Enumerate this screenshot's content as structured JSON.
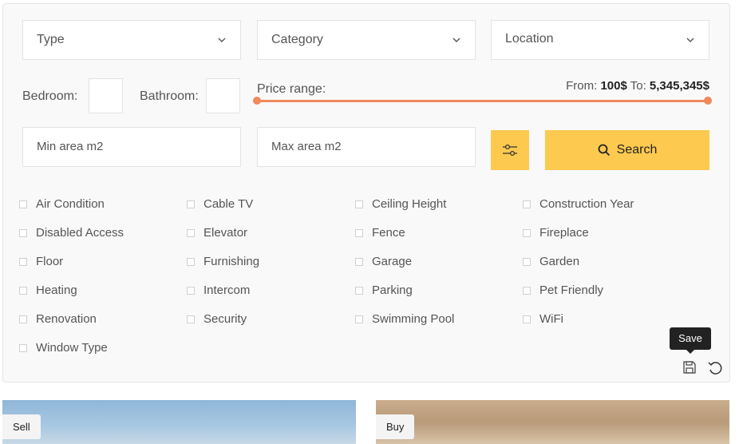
{
  "selects": {
    "type": "Type",
    "category": "Category",
    "location": "Location"
  },
  "rooms": {
    "bedroom_label": "Bedroom:",
    "bathroom_label": "Bathroom:"
  },
  "price": {
    "label": "Price range:",
    "from_label": "From:",
    "from_value": "100$",
    "to_label": "To:",
    "to_value": "5,345,345$",
    "range_fraction": [
      0.0,
      1.0
    ]
  },
  "area": {
    "min_placeholder": "Min area m2",
    "max_placeholder": "Max area m2"
  },
  "buttons": {
    "search_label": "Search",
    "save_tooltip": "Save"
  },
  "amenities": [
    "Air Condition",
    "Cable TV",
    "Ceiling Height",
    "Construction Year",
    "Disabled Access",
    "Elevator",
    "Fence",
    "Fireplace",
    "Floor",
    "Furnishing",
    "Garage",
    "Garden",
    "Heating",
    "Intercom",
    "Parking",
    "Pet Friendly",
    "Renovation",
    "Security",
    "Swimming Pool",
    "WiFi",
    "Window Type"
  ],
  "cards": [
    {
      "badge": "Sell"
    },
    {
      "badge": "Buy"
    }
  ],
  "colors": {
    "accent": "#fdc94f",
    "range": "#f08a5d"
  },
  "icons": {
    "chevron": "chevron-down-icon",
    "filter": "sliders-icon",
    "search": "search-icon",
    "save": "save-icon",
    "reset": "undo-icon"
  }
}
